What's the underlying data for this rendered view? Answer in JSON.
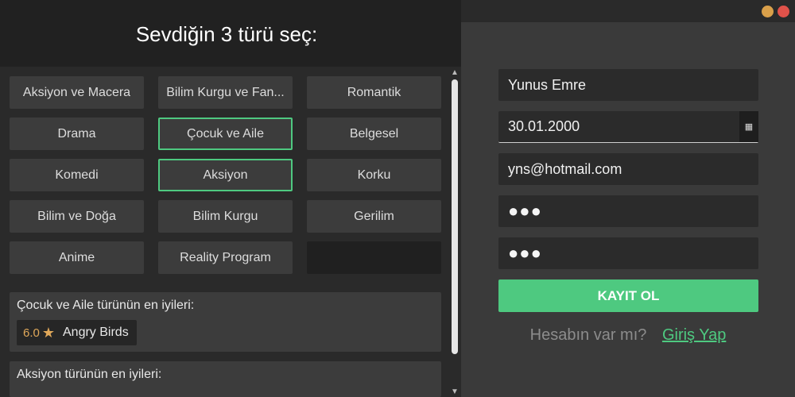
{
  "header": {
    "title": "Sevdiğin 3 türü seç:"
  },
  "genres": [
    {
      "label": "Aksiyon ve Macera",
      "selected": false
    },
    {
      "label": "Bilim Kurgu ve Fan...",
      "selected": false
    },
    {
      "label": "Romantik",
      "selected": false
    },
    {
      "label": "Drama",
      "selected": false
    },
    {
      "label": "Çocuk ve Aile",
      "selected": true
    },
    {
      "label": "Belgesel",
      "selected": false
    },
    {
      "label": "Komedi",
      "selected": false
    },
    {
      "label": "Aksiyon",
      "selected": true
    },
    {
      "label": "Korku",
      "selected": false
    },
    {
      "label": "Bilim ve Doğa",
      "selected": false
    },
    {
      "label": "Bilim Kurgu",
      "selected": false
    },
    {
      "label": "Gerilim",
      "selected": false
    },
    {
      "label": "Anime",
      "selected": false
    },
    {
      "label": "Reality Program",
      "selected": false
    },
    {
      "label": "",
      "selected": false
    }
  ],
  "recommendations": [
    {
      "title": "Çocuk ve Aile türünün en iyileri:",
      "movies": [
        {
          "rating": "6.0",
          "name": "Angry Birds"
        }
      ]
    },
    {
      "title": "Aksiyon türünün en iyileri:",
      "movies": []
    }
  ],
  "form": {
    "name": "Yunus Emre",
    "birthdate": "30.01.2000",
    "calendar_icon": "calendar-icon",
    "email": "yns@hotmail.com",
    "password": "●●●",
    "password_confirm": "●●●",
    "register_label": "KAYIT OL"
  },
  "login": {
    "question": "Hesabın var mı?",
    "link": "Giriş Yap"
  },
  "colors": {
    "accent": "#4ec980",
    "window_minimize": "#d9a04a",
    "window_close": "#e0524a",
    "star": "#e0a85a"
  },
  "icons": {
    "star": "star-icon",
    "scroll_up": "chevron-up-icon",
    "scroll_down": "chevron-down-icon"
  }
}
